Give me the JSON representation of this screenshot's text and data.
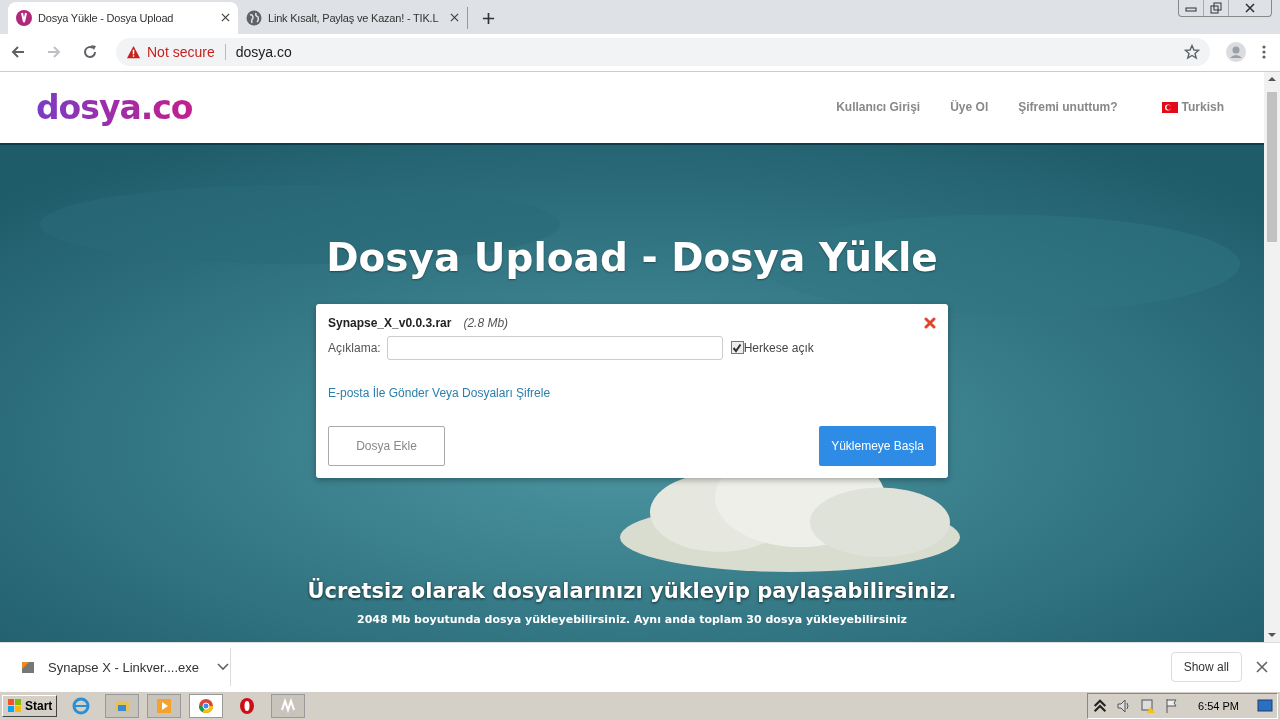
{
  "tabs": [
    {
      "title": "Dosya Yükle - Dosya Upload",
      "selected": true,
      "kind": "site"
    },
    {
      "title": "Link Kısalt, Paylaş ve Kazan! - TIK.L",
      "selected": false,
      "kind": "globe"
    }
  ],
  "address": {
    "security": "Not secure",
    "url": "dosya.co"
  },
  "site": {
    "logo": "dosya.co",
    "nav": [
      "Kullanıcı Girişi",
      "Üye Ol",
      "Şifremi unuttum?"
    ],
    "language": "Turkish"
  },
  "hero": {
    "title": "Dosya Upload - Dosya Yükle",
    "tagline": "Ücretsiz olarak dosyalarınızı yükleyip paylaşabilirsiniz.",
    "subtext": "2048 Mb boyutunda dosya yükleyebilirsiniz. Aynı anda toplam 30 dosya yükleyebilirsiniz"
  },
  "upload": {
    "filename": "Synapse_X_v0.0.3.rar",
    "size": "(2.8 Mb)",
    "description_label": "Açıklama:",
    "public": {
      "label": "Herkese açık",
      "checked": true
    },
    "link": "E-posta İle Gönder Veya Dosyaları Şifrele",
    "add_button": "Dosya Ekle",
    "start_button": "Yüklemeye Başla"
  },
  "download_bar": {
    "file": "Synapse X - Linkver....exe",
    "show_all": "Show all"
  },
  "taskbar": {
    "start": "Start",
    "clock": "6:54 PM"
  }
}
